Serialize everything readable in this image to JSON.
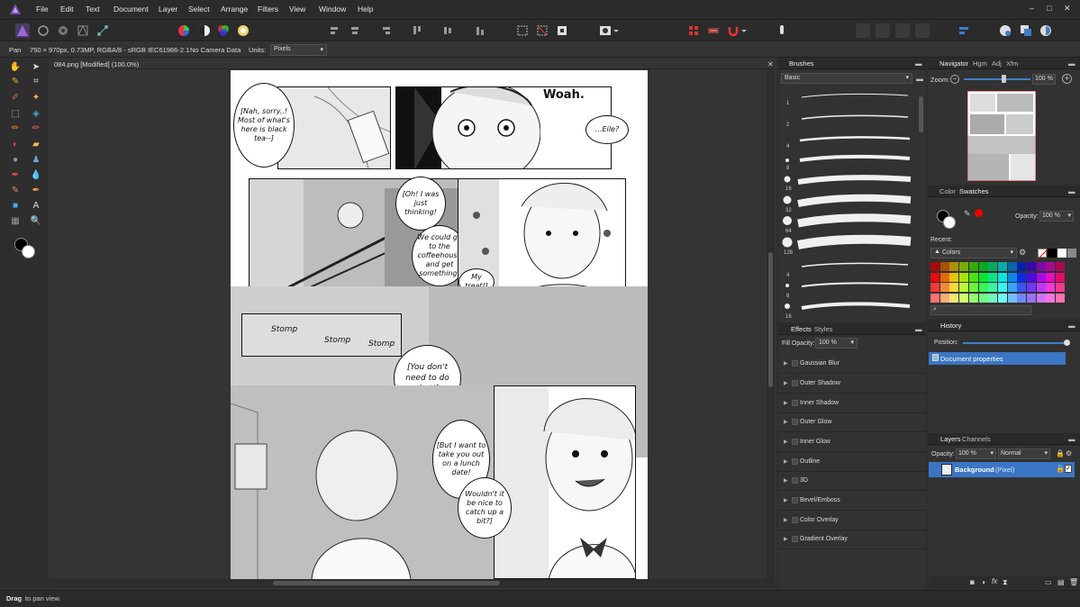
{
  "menubar": {
    "items": [
      "File",
      "Edit",
      "Text",
      "Document",
      "Layer",
      "Select",
      "Arrange",
      "Filters",
      "View",
      "Window",
      "Help"
    ],
    "window_controls": {
      "minimize": "‒",
      "maximize": "□",
      "close": "✕"
    }
  },
  "context": {
    "tool": "Pan",
    "doc_info": "750 × 970px, 0.73MP, RGBA/8 - sRGB IEC61966-2.1",
    "camera": "No Camera Data",
    "units_label": "Units:",
    "units_value": "Pixels"
  },
  "document": {
    "tab_title": "084.png [Modified] (100.0%)"
  },
  "comic": {
    "bubbles": {
      "b1": "[Nah, sorry..! Most of what's here is black tea--]",
      "b2": "...Eile?",
      "b3": "[Oh! I was just thinking!",
      "b4": "We could go to the coffeehouse and get something!",
      "b5": "My treat!]",
      "b6": "[You don't need to do that!]",
      "b7": "[But I want to take you out on a lunch date!",
      "b8": "Wouldn't it be nice to catch up a bit?]"
    },
    "sfx": {
      "woah": "Woah.",
      "stomp1": "Stomp",
      "stomp2": "Stomp",
      "stomp3": "Stomp"
    }
  },
  "brushes_panel": {
    "tab": "Brushes",
    "category": "Basic",
    "sizes": [
      "1",
      "2",
      "4",
      "8",
      "16",
      "32",
      "64",
      "128",
      "4",
      "8",
      "16"
    ]
  },
  "navigator_panel": {
    "tabs": [
      "Navigator",
      "Hgm",
      "Adj",
      "Xfm"
    ],
    "zoom_label": "Zoom:",
    "zoom_value": "100 %"
  },
  "swatches_panel": {
    "tabs": [
      "Color",
      "Swatches"
    ],
    "opacity_label": "Opacity:",
    "opacity_value": "100 %",
    "recent_label": "Recent:",
    "palette": "Colors"
  },
  "effects_panel": {
    "tabs": [
      "Effects",
      "Styles"
    ],
    "fill_opacity_label": "Fill Opacity:",
    "fill_opacity_value": "100 %",
    "effects": [
      "Gaussian Blur",
      "Outer Shadow",
      "Inner Shadow",
      "Outer Glow",
      "Inner Glow",
      "Outline",
      "3D",
      "Bevel/Emboss",
      "Color Overlay",
      "Gradient Overlay"
    ]
  },
  "history_panel": {
    "tab": "History",
    "position_label": "Position:",
    "entries": [
      "Document properties"
    ]
  },
  "layers_panel": {
    "tabs": [
      "Layers",
      "Channels"
    ],
    "opacity_label": "Opacity:",
    "opacity_value": "100 %",
    "blend_mode": "Normal",
    "layer_name": "Background",
    "layer_type": "(Pixel)"
  },
  "status": {
    "bold": "Drag",
    "text": "to pan view."
  },
  "colors": {
    "accent": "#3d7fc9",
    "selection": "#3b76c4",
    "brand": "#7b4bb7"
  }
}
